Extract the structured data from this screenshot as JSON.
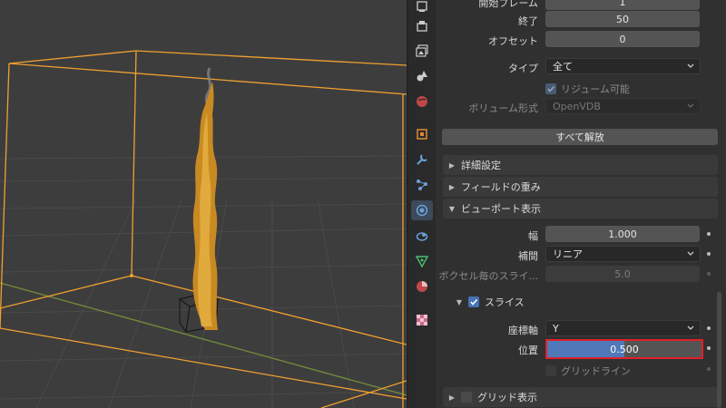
{
  "domain_view": "3d-viewport",
  "props": {
    "start_frame": {
      "label": "開始フレーム",
      "value": "1"
    },
    "end_frame": {
      "label": "終了",
      "value": "50"
    },
    "offset": {
      "label": "オフセット",
      "value": "0"
    },
    "type": {
      "label": "タイプ",
      "value": "全て"
    },
    "volume_enabled": {
      "label": "リジューム可能",
      "checked": true
    },
    "volume_format": {
      "label": "ボリューム形式",
      "value": "OpenVDB"
    },
    "free_all": {
      "label": "すべて解放"
    },
    "panels": {
      "advanced": "詳細設定",
      "field_weights": "フィールドの重み",
      "viewport_display": "ビューポート表示"
    },
    "thickness": {
      "label": "幅",
      "value": "1.000"
    },
    "interpolation": {
      "label": "補間",
      "value": "リニア"
    },
    "slices_per_voxel": {
      "label": "ボクセル毎のスライ...",
      "value": "5.0"
    },
    "slice": {
      "label": "スライス",
      "checked": true
    },
    "axis": {
      "label": "座標軸",
      "value": "Y"
    },
    "position": {
      "label": "位置",
      "value": "0.500",
      "fraction": 0.5
    },
    "gridlines": {
      "label": "グリッドライン",
      "checked": false
    },
    "grid_display": {
      "label": "グリッド表示",
      "checked": false
    }
  },
  "tabs": [
    "render-icon",
    "output-icon",
    "view-layer-icon",
    "scene-icon",
    "world-icon",
    "object-icon",
    "modifier-icon",
    "particles-icon",
    "physics-icon",
    "constraints-icon",
    "data-icon",
    "material-icon",
    "texture-icon"
  ],
  "colors": {
    "selection_outline": "#f0a030",
    "highlight_border": "#e0202a",
    "slider_fill": "#4f79b9",
    "checkbox_on": "#4772b3"
  }
}
